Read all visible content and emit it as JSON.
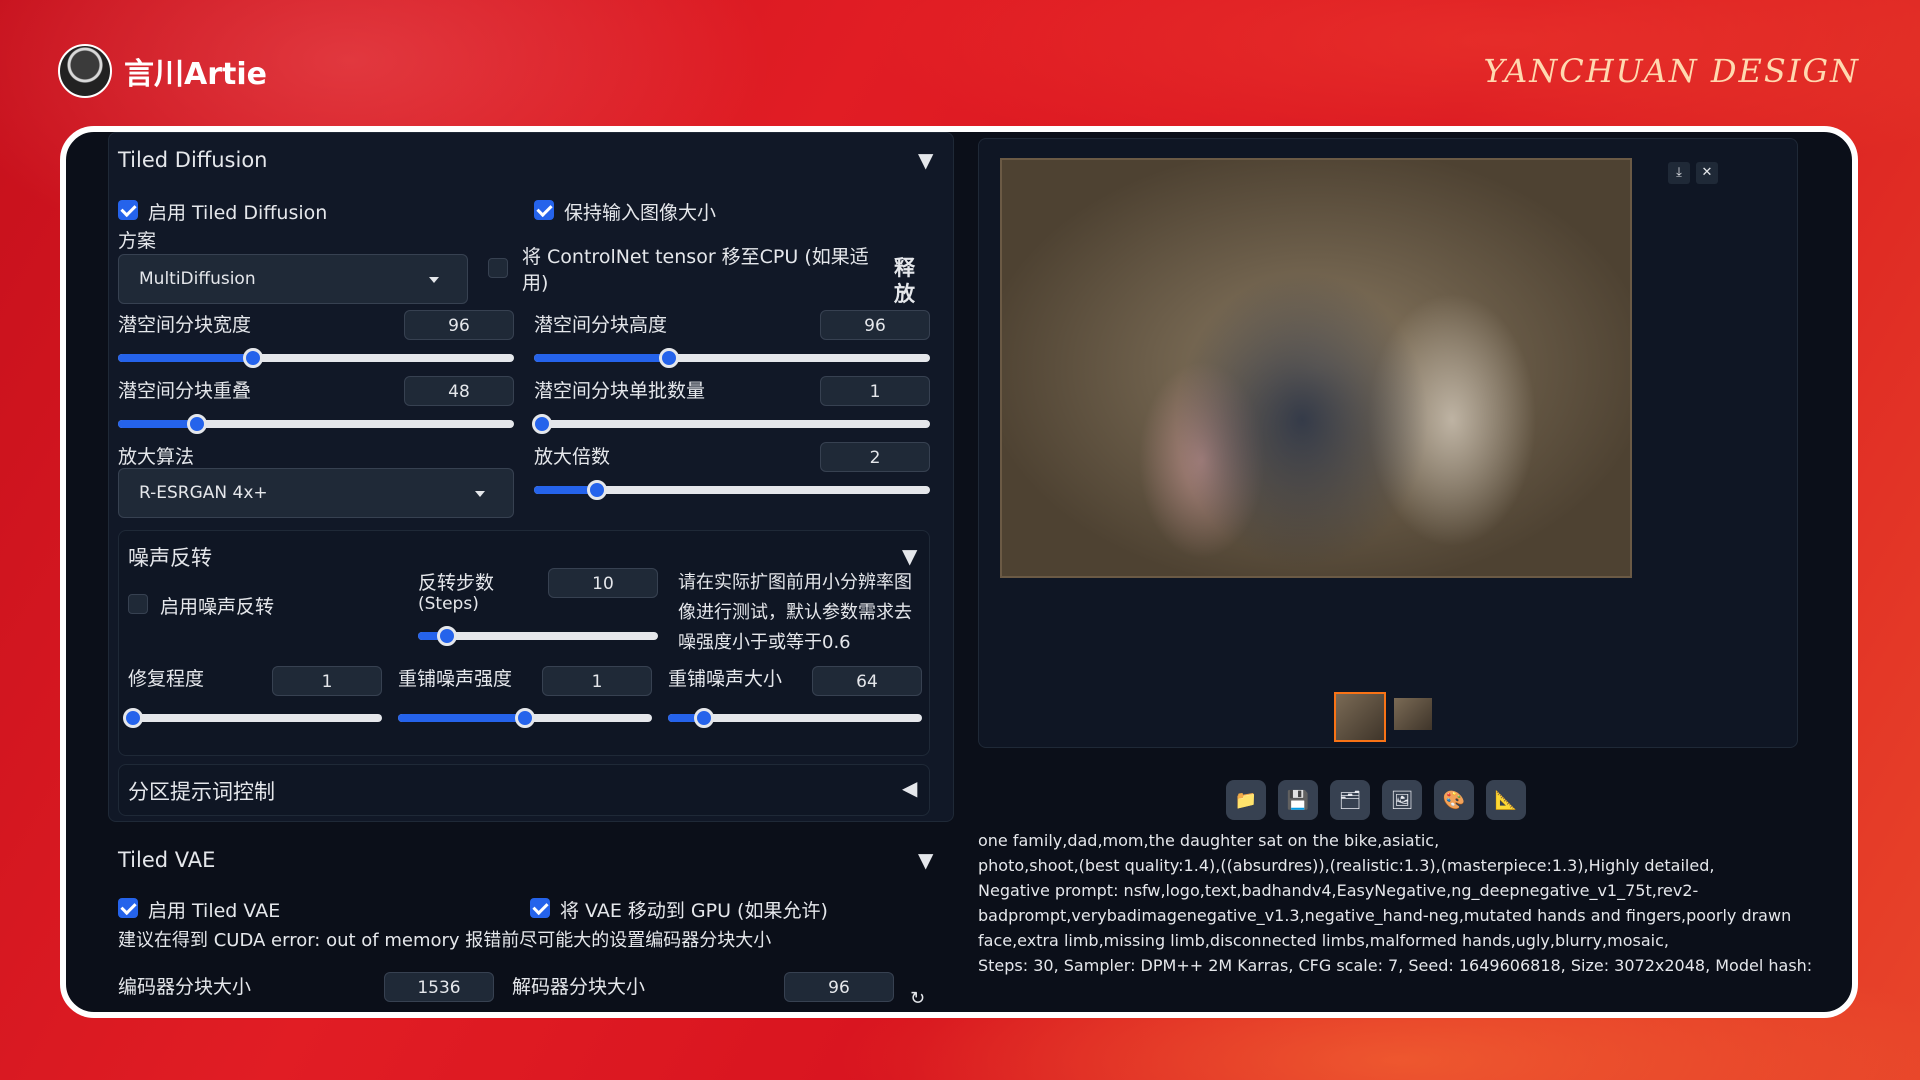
{
  "brand": {
    "name": "言川Artie",
    "design": "YANCHUAN DESIGN"
  },
  "colors": {
    "accent": "#2563eb",
    "frame_bg": "#0b0f19",
    "panel_bg": "#111827"
  },
  "tiled_diffusion": {
    "title": "Tiled Diffusion",
    "enable_label": "启用 Tiled Diffusion",
    "enable_checked": true,
    "keep_size_label": "保持输入图像大小",
    "keep_size_checked": true,
    "method_label": "方案",
    "method_value": "MultiDiffusion",
    "controlnet_cpu_label_line1": "将 ControlNet tensor 移至CPU (如果适",
    "controlnet_cpu_label_line2": "用)",
    "controlnet_cpu_checked": false,
    "release_label_1": "释",
    "release_label_2": "放",
    "tile_width_label": "潜空间分块宽度",
    "tile_width_value": "96",
    "tile_width_fraction": 0.34,
    "tile_height_label": "潜空间分块高度",
    "tile_height_value": "96",
    "tile_height_fraction": 0.34,
    "tile_overlap_label": "潜空间分块重叠",
    "tile_overlap_value": "48",
    "tile_overlap_fraction": 0.2,
    "tile_batch_label": "潜空间分块单批数量",
    "tile_batch_value": "1",
    "tile_batch_fraction": 0.02,
    "upscaler_label": "放大算法",
    "upscaler_value": "R-ESRGAN 4x+",
    "scale_label": "放大倍数",
    "scale_value": "2",
    "scale_fraction": 0.16
  },
  "noise_inversion": {
    "title": "噪声反转",
    "enable_label": "启用噪声反转",
    "enable_checked": false,
    "steps_label_line1": "反转步数",
    "steps_label_line2": "(Steps)",
    "steps_value": "10",
    "steps_fraction": 0.12,
    "hint_line1": "请在实际扩图前用小分辨率图",
    "hint_line2": "像进行测试，默认参数需求去",
    "hint_line3": "噪强度小于或等于0.6",
    "retouch_label": "修复程度",
    "retouch_value": "1",
    "retouch_fraction": 0.02,
    "renoise_strength_label": "重铺噪声强度",
    "renoise_strength_value": "1",
    "renoise_strength_fraction": 0.5,
    "renoise_size_label": "重铺噪声大小",
    "renoise_size_value": "64",
    "renoise_size_fraction": 0.14
  },
  "region_prompt": {
    "title": "分区提示词控制"
  },
  "tiled_vae": {
    "title": "Tiled VAE",
    "enable_label": "启用 Tiled VAE",
    "enable_checked": true,
    "move_gpu_label": "将 VAE 移动到 GPU (如果允许)",
    "move_gpu_checked": true,
    "advice": "建议在得到 CUDA error: out of memory 报错前尽可能大的设置编码器分块大小",
    "encoder_label": "编码器分块大小",
    "encoder_value": "1536",
    "decoder_label": "解码器分块大小",
    "decoder_value": "96"
  },
  "gallery": {
    "download_icon": "download-icon",
    "close_icon": "close-icon",
    "tools": [
      "folder-icon",
      "save-icon",
      "zip-icon",
      "image-icon",
      "palette-icon",
      "ruler-icon"
    ]
  },
  "generation_info": {
    "line1": "one family,dad,mom,the daughter sat on the bike,asiatic,",
    "line2": "photo,shoot,(best quality:1.4),((absurdres)),(realistic:1.3),(masterpiece:1.3),Highly detailed,",
    "line3": "Negative prompt: nsfw,logo,text,badhandv4,EasyNegative,ng_deepnegative_v1_75t,rev2-",
    "line4": "badprompt,verybadimagenegative_v1.3,negative_hand-neg,mutated hands and fingers,poorly drawn",
    "line5": "face,extra limb,missing limb,disconnected limbs,malformed hands,ugly,blurry,mosaic,",
    "line6": "Steps: 30, Sampler: DPM++ 2M Karras, CFG scale: 7, Seed: 1649606818, Size: 3072x2048, Model hash:"
  }
}
